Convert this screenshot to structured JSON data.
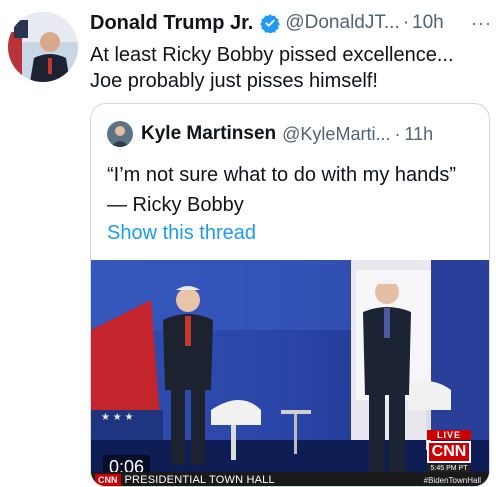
{
  "tweet": {
    "author_name": "Donald Trump Jr.",
    "handle": "@DonaldJT...",
    "separator": "·",
    "time": "10h",
    "more": "···",
    "text": "At least Ricky Bobby pissed excellence... Joe probably just pisses himself!"
  },
  "quote": {
    "author_name": "Kyle Martinsen",
    "handle": "@KyleMarti...",
    "separator": "·",
    "time": "11h",
    "text": "“I’m not sure what to do with my hands” — Ricky Bobby",
    "show_thread": "Show this thread"
  },
  "video": {
    "duration": "0:06",
    "lower_third_logo": "CNN",
    "lower_third_title": "PRESIDENTIAL TOWN HALL",
    "hashtag": "#BidenTownHall",
    "live_label": "LIVE",
    "network_logo": "CNN",
    "clock": "5:45 PM PT"
  },
  "colors": {
    "link": "#1d9bf0",
    "verified": "#1d9bf0",
    "muted": "#536471",
    "cnn_red": "#cc0000"
  }
}
